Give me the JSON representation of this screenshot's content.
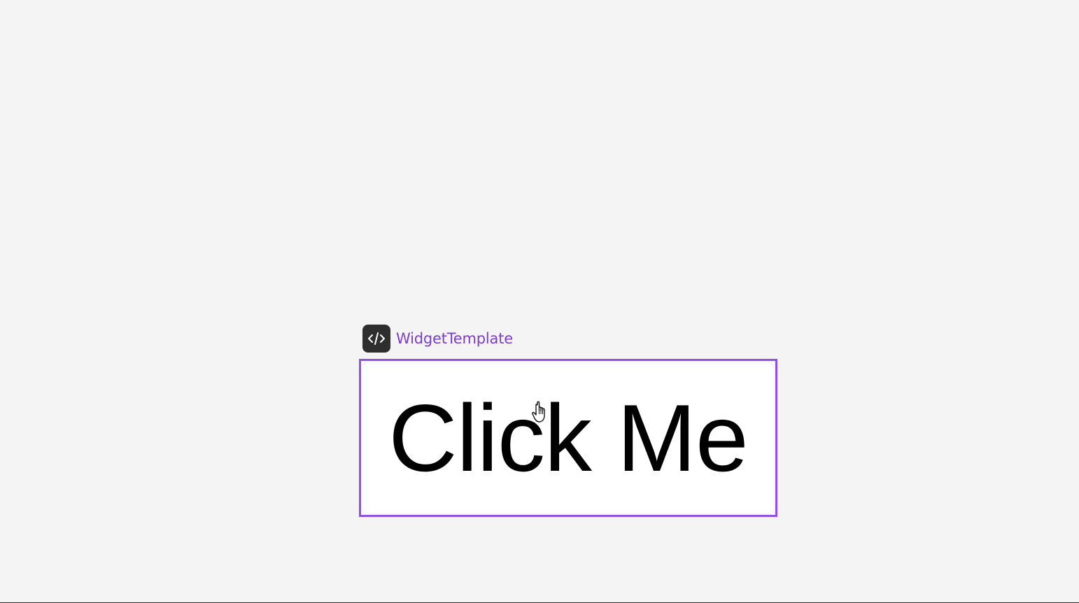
{
  "widget": {
    "tag_icon": "code-icon",
    "tag_label": "WidgetTemplate",
    "button_label": "Click Me"
  },
  "cursor": {
    "icon": "hand-pointer-icon"
  },
  "colors": {
    "accent": "#9050e0",
    "tag_text": "#7b3fc9",
    "tag_icon_bg": "#2e2e2e",
    "canvas_bg": "#f4f4f4",
    "button_bg": "#ffffff"
  }
}
